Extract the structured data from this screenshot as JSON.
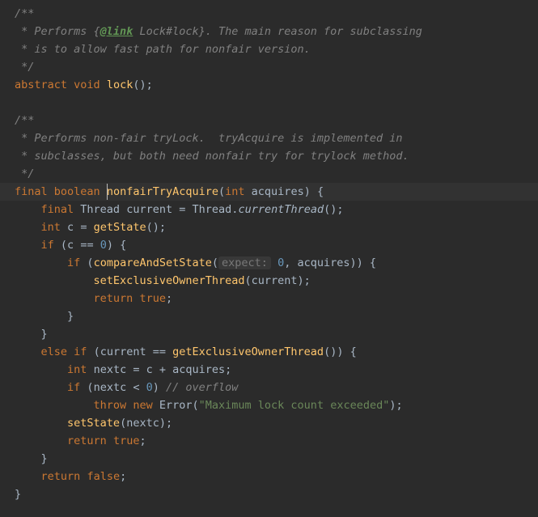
{
  "colors": {
    "background": "#2b2b2b",
    "foreground": "#a9b7c6",
    "keyword": "#cc7832",
    "method": "#ffc66d",
    "string": "#6a8759",
    "number": "#6897bb",
    "comment": "#808080",
    "docTag": "#629755",
    "paramHintBg": "#383838",
    "paramHintFg": "#787878",
    "highlightLine": "#323232"
  },
  "doc1": {
    "open": "/**",
    "l1a": " * Performs {",
    "l1tag": "@link",
    "l1b": " Lock#lock}. The main reason for subclassing",
    "l2": " * is to allow fast path for nonfair version.",
    "close": " */"
  },
  "sig1": {
    "kw1": "abstract",
    "kw2": "void",
    "name": "lock",
    "post": "();"
  },
  "doc2": {
    "open": "/**",
    "l1": " * Performs non-fair tryLock.  tryAcquire is implemented in",
    "l2": " * subclasses, but both need nonfair try for trylock method.",
    "close": " */"
  },
  "m": {
    "kw1": "final",
    "kw2": "boolean",
    "name": "nonfairTryAcquire",
    "pOpen": "(",
    "pType": "int",
    "pName": "acquires",
    "pClose": ") {",
    "l1": {
      "kw": "final",
      "type": "Thread",
      "var": "current",
      "eq": " = ",
      "cls": "Thread",
      "dot": ".",
      "call": "currentThread",
      "end": "();"
    },
    "l2": {
      "type": "int",
      "var": "c",
      "eq": " = ",
      "call": "getState",
      "end": "();"
    },
    "if1": {
      "kw": "if",
      "open": " (",
      "lhs": "c",
      "op": " == ",
      "rhs": "0",
      "close": ") {"
    },
    "if1a": {
      "kw": "if",
      "open": " (",
      "call": "compareAndSetState",
      "p1": "(",
      "hint": "expect:",
      "sp": " ",
      "n0": "0",
      "comma": ", ",
      "arg2": "acquires",
      "p2": ")) {"
    },
    "if1b": {
      "call": "setExclusiveOwnerThread",
      "open": "(",
      "arg": "current",
      "close": ");"
    },
    "if1c": {
      "kw": "return",
      "sp": " ",
      "val": "true",
      "end": ";"
    },
    "closeBrace": "}",
    "elseif": {
      "kw1": "else",
      "sp1": " ",
      "kw2": "if",
      "open": " (",
      "lhs": "current",
      "op": " == ",
      "call": "getExclusiveOwnerThread",
      "close": "()) {"
    },
    "e1": {
      "type": "int",
      "var": "nextc",
      "eq": " = ",
      "lhs": "c",
      "op": " + ",
      "rhs": "acquires",
      "end": ";"
    },
    "e2": {
      "kw": "if",
      "open": " (",
      "lhs": "nextc",
      "op": " < ",
      "rhs": "0",
      "close": ") ",
      "comment": "// overflow"
    },
    "e3": {
      "kw": "throw",
      "sp": " ",
      "kw2": "new",
      "sp2": " ",
      "cls": "Error",
      "open": "(",
      "str": "\"Maximum lock count exceeded\"",
      "close": ");"
    },
    "e4": {
      "call": "setState",
      "open": "(",
      "arg": "nextc",
      "close": ");"
    },
    "e5": {
      "kw": "return",
      "sp": " ",
      "val": "true",
      "end": ";"
    },
    "ret": {
      "kw": "return",
      "sp": " ",
      "val": "false",
      "end": ";"
    }
  }
}
